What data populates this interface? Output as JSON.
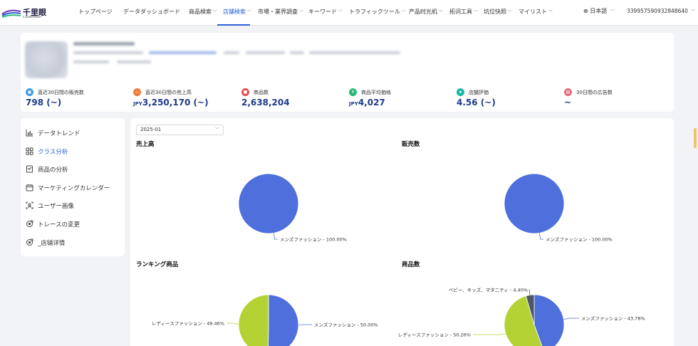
{
  "brand": {
    "name": "千里眼",
    "sub": "CLAIRVOYANT"
  },
  "nav": {
    "items": [
      {
        "label": "トップページ",
        "dropdown": false
      },
      {
        "label": "データダッシュボード",
        "dropdown": false
      },
      {
        "label": "商品検索",
        "dropdown": true
      },
      {
        "label": "店舗検索",
        "dropdown": true,
        "active": true
      },
      {
        "label": "市場・業界調査",
        "dropdown": true
      },
      {
        "label": "キーワード",
        "dropdown": true
      },
      {
        "label": "トラフィックツール",
        "dropdown": true
      },
      {
        "label": "产品时光机",
        "dropdown": true
      },
      {
        "label": "拓词工具",
        "dropdown": true
      },
      {
        "label": "坑位快照",
        "dropdown": true
      },
      {
        "label": "マイリスト",
        "dropdown": true
      }
    ],
    "language": "日本語",
    "user_id": "33995759093284864​0"
  },
  "shop": {
    "metrics": [
      {
        "label": "直近30日間の販売数",
        "currency": "",
        "value": "798 (~)",
        "icon": "cart-icon",
        "color": "#3d9be9"
      },
      {
        "label": "直近30日間の売上高",
        "currency": "JPY",
        "value": "3,250,170 (~)",
        "icon": "fire-icon",
        "color": "#f07c3b"
      },
      {
        "label": "商品数",
        "currency": "",
        "value": "2,638,204",
        "icon": "box-icon",
        "color": "#e5484d"
      },
      {
        "label": "商品平均価格",
        "currency": "JPY",
        "value": "4,027",
        "icon": "price-tag-icon",
        "color": "#2bb673"
      },
      {
        "label": "店舗評価",
        "currency": "",
        "value": "4.56 (~)",
        "icon": "star-icon",
        "color": "#18b7a8"
      },
      {
        "label": "30日間の広告数",
        "currency": "",
        "value": "~",
        "icon": "ad-icon",
        "color": "#e46b7b"
      }
    ]
  },
  "sidebar": {
    "items": [
      {
        "label": "データトレンド",
        "icon": "bar-chart-icon",
        "active": false
      },
      {
        "label": "クラス分析",
        "icon": "grid-icon",
        "active": true
      },
      {
        "label": "商品の分析",
        "icon": "document-icon",
        "active": false
      },
      {
        "label": "マーケティングカレンダー",
        "icon": "calendar-icon",
        "active": false
      },
      {
        "label": "ユーザー画像",
        "icon": "user-scan-icon",
        "active": false
      },
      {
        "label": "トレースの変更",
        "icon": "target-icon",
        "active": false
      },
      {
        "label": "_店铺详情",
        "icon": "target-icon",
        "active": false
      }
    ]
  },
  "filter": {
    "month": "2025-01"
  },
  "colors": {
    "blue": "#4e6fdc",
    "green": "#b5d235",
    "dark": "#4d5566",
    "accent": "#2b62d9"
  },
  "chart_data": [
    {
      "type": "pie",
      "title": "売上高",
      "labels": [
        "メンズファッション"
      ],
      "values": [
        100.0
      ],
      "data_labels": [
        "メンズファッション - 100.00%"
      ]
    },
    {
      "type": "pie",
      "title": "販売数",
      "labels": [
        "メンズファッション"
      ],
      "values": [
        100.0
      ],
      "data_labels": [
        "メンズファッション - 100.00%"
      ]
    },
    {
      "type": "pie",
      "title": "ランキング商品",
      "labels": [
        "メンズファッション",
        "レディースファッション"
      ],
      "values": [
        50.0,
        49.46
      ],
      "data_labels": [
        "メンズファッション - 50.00%",
        "レディースファッション - 49.46%"
      ]
    },
    {
      "type": "pie",
      "title": "商品数",
      "labels": [
        "メンズファッション",
        "レディースファッション",
        "ベビー、キッズ、マタニティ"
      ],
      "values": [
        43.78,
        50.26,
        4.4
      ],
      "data_labels": [
        "メンズファッション - 43.78%",
        "レディースファッション - 50.26%",
        "ベビー、キッズ、マタニティ - 4.40%"
      ]
    }
  ]
}
